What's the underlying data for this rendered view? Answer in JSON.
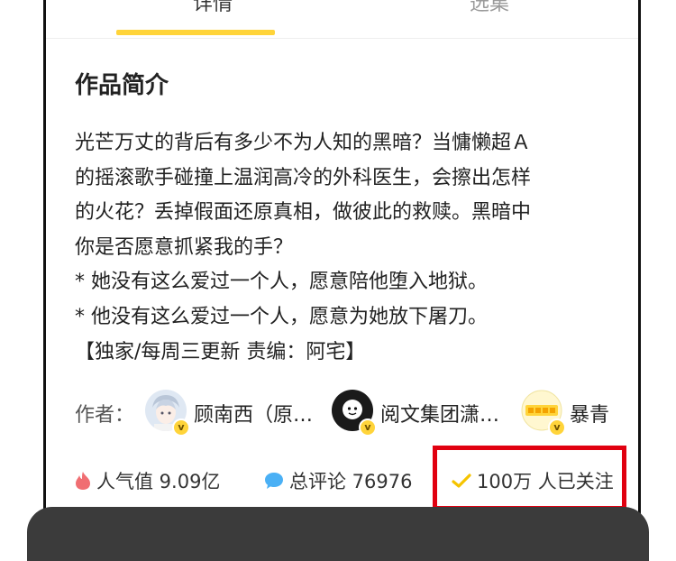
{
  "tabs": [
    {
      "label": "详情",
      "selected": true
    },
    {
      "label": "选集",
      "selected": false
    }
  ],
  "intro": {
    "title": "作品简介",
    "lines": [
      "光芒万丈的背后有多少不为人知的黑暗？当慵懒超Ａ",
      "的摇滚歌手碰撞上温润高冷的外科医生，会擦出怎样",
      "的火花？丢掉假面还原真相，做彼此的救赎。黑暗中",
      "你是否愿意抓紧我的手？",
      "* 她没有这么爱过一个人，愿意陪他堕入地狱。",
      "* 他没有这么爱过一个人，愿意为她放下屠刀。",
      "【独家/每周三更新 责编：阿宅】"
    ]
  },
  "authors": {
    "label": "作者：",
    "items": [
      {
        "name": "顾南西（原…",
        "avatar": "anime-boy-avatar",
        "badge": "v"
      },
      {
        "name": "阅文集团潇…",
        "avatar": "black-mascot-avatar",
        "badge": "v"
      },
      {
        "name": "暴青",
        "avatar": "yellow-logo-avatar",
        "badge": "v"
      }
    ]
  },
  "stats": {
    "popularity": {
      "icon": "flame-icon",
      "text": "人气值 9.09亿"
    },
    "comments": {
      "icon": "comment-bubble-icon",
      "text": "总评论 76976"
    },
    "followers": {
      "icon": "check-icon",
      "text": "100万 人已关注"
    }
  },
  "colors": {
    "accent": "#ffd43a",
    "highlight": "#e10010",
    "flame": "#f06e72",
    "bubble": "#4ab0f5"
  }
}
